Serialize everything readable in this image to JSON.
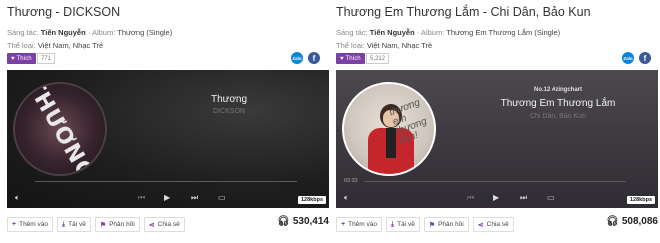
{
  "panels": [
    {
      "title": "Thương",
      "title_sep": " - ",
      "artist": "DICKSON",
      "composer_label": "Sáng tác:",
      "composer": "Tiến Nguyễn",
      "album_label": "Album:",
      "album": "Thương (Single)",
      "genre_label": "Thể loại:",
      "genres": "Việt Nam, Nhạc Trẻ",
      "like_label": "Thích",
      "like_count": "771",
      "player": {
        "cover_text": "THƯƠNG",
        "chart_label": "",
        "song": "Thương",
        "artist": "DICKSON",
        "time": "",
        "progress": 0,
        "quality": "128kbps"
      },
      "actions": [
        "Thêm vào",
        "Tải về",
        "Phản hồi",
        "Chia sẻ"
      ],
      "listen_count": "530,414"
    },
    {
      "title": "Thương Em Thương Lắm",
      "title_sep": " - ",
      "artist": "Chi Dân, Bảo Kun",
      "composer_label": "Sáng tác:",
      "composer": "Tiến Nguyễn",
      "album_label": "Album:",
      "album": "Thương Em Thương Lắm (Single)",
      "genre_label": "Thể loại:",
      "genres": "Việt Nam, Nhạc Trẻ",
      "like_label": "Thích",
      "like_count": "5,212",
      "player": {
        "cover_text": "thương em thương lắm!",
        "chart_label": "No.12 #zingchart",
        "song": "Thương Em Thương Lắm",
        "artist": "Chi Dân, Bảo Kun",
        "time": "03:32",
        "progress": 0,
        "quality": "128kbps"
      },
      "actions": [
        "Thêm vào",
        "Tải về",
        "Phản hồi",
        "Chia sẻ"
      ],
      "listen_count": "508,086"
    }
  ],
  "share": {
    "zalo": "Zalo",
    "facebook": "f"
  },
  "colors": {
    "accent": "#7b3fa6",
    "zalo": "#0b84d8",
    "facebook": "#3b5998"
  },
  "icons": {
    "heart": "heart-icon",
    "plus": "plus-icon",
    "download": "download-icon",
    "flag": "flag-icon",
    "share": "share-icon",
    "headphones": "headphones-icon",
    "volume": "volume-icon",
    "prev": "prev-icon",
    "play": "play-icon",
    "next": "next-icon",
    "repeat": "repeat-icon"
  }
}
